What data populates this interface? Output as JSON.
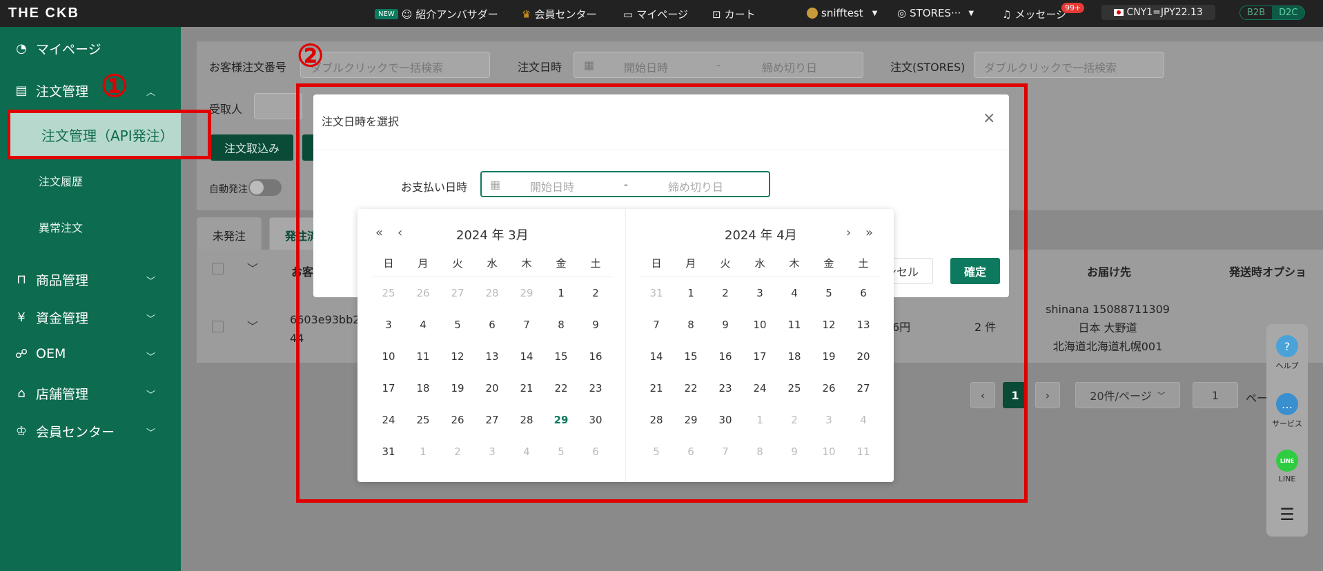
{
  "topbar": {
    "logo": "THE CKB",
    "new_badge": "NEW",
    "ambassador": "紹介アンバサダー",
    "member_center": "会員センター",
    "mypage": "マイページ",
    "cart": "カート",
    "user": "snifftest",
    "store": "STORES···",
    "messages": "メッセージ",
    "msg_count": "99+",
    "rate": "CNY1=JPY22.13",
    "b2b": "B2B",
    "d2c": "D2C"
  },
  "sidebar": {
    "mypage": "マイページ",
    "order_mgmt": "注文管理",
    "order_api": "注文管理（API発注）",
    "order_history": "注文履歴",
    "abnormal": "異常注文",
    "product": "商品管理",
    "funds": "資金管理",
    "oem": "OEM",
    "store": "店舗管理",
    "member": "会員センター"
  },
  "filters": {
    "customer_order_label": "お客様注文番号",
    "customer_order_placeholder": "ダブルクリックで一括検索",
    "order_date_label": "注文日時",
    "start": "開始日時",
    "dash": "-",
    "end": "締め切り日",
    "stores_label": "注文(STORES)",
    "stores_placeholder": "ダブルクリックで一括検索",
    "recipient_label": "受取人",
    "import_button": "注文取込み",
    "auto_label": "自動発注"
  },
  "tabs": [
    "未発注",
    "発注済"
  ],
  "table": {
    "col_customer": "お客",
    "col_delivery": "お届け先",
    "col_option": "発送時オプショ",
    "row_id1": "6603e93bb2",
    "row_id2": "44",
    "row_price": "6円",
    "row_qty": "2 件",
    "row_addr1": "shinana 15088711309",
    "row_addr2": "日本 大野道",
    "row_addr3": "北海道北海道札幌001"
  },
  "pagination": {
    "page": "1",
    "per_page": "20件/ページ",
    "goto": "1",
    "goto_suffix": "ペー"
  },
  "float": {
    "help": "ヘルプ",
    "service": "サービス",
    "line": "LINE",
    "line_icon": "LINE"
  },
  "modal": {
    "title": "注文日時を選択",
    "pay_label": "お支払い日時",
    "start": "開始日時",
    "dash": "-",
    "end": "締め切り日",
    "cancel": "ンセル",
    "confirm": "確定"
  },
  "calendar": {
    "weekdays": [
      "日",
      "月",
      "火",
      "水",
      "木",
      "金",
      "土"
    ],
    "left_title": "2024 年 3月",
    "right_title": "2024 年 4月",
    "today": "29",
    "left_days": [
      [
        "25",
        "26",
        "27",
        "28",
        "29",
        "1",
        "2"
      ],
      [
        "3",
        "4",
        "5",
        "6",
        "7",
        "8",
        "9"
      ],
      [
        "10",
        "11",
        "12",
        "13",
        "14",
        "15",
        "16"
      ],
      [
        "17",
        "18",
        "19",
        "20",
        "21",
        "22",
        "23"
      ],
      [
        "24",
        "25",
        "26",
        "27",
        "28",
        "29",
        "30"
      ],
      [
        "31",
        "1",
        "2",
        "3",
        "4",
        "5",
        "6"
      ]
    ],
    "right_days": [
      [
        "31",
        "1",
        "2",
        "3",
        "4",
        "5",
        "6"
      ],
      [
        "7",
        "8",
        "9",
        "10",
        "11",
        "12",
        "13"
      ],
      [
        "14",
        "15",
        "16",
        "17",
        "18",
        "19",
        "20"
      ],
      [
        "21",
        "22",
        "23",
        "24",
        "25",
        "26",
        "27"
      ],
      [
        "28",
        "29",
        "30",
        "1",
        "2",
        "3",
        "4"
      ],
      [
        "5",
        "6",
        "7",
        "8",
        "9",
        "10",
        "11"
      ]
    ]
  },
  "annotations": {
    "one": "①",
    "two": "②",
    "color": "#e00000"
  },
  "colors": {
    "brand": "#0d7a5f",
    "sidebar": "#0d6b4f"
  }
}
